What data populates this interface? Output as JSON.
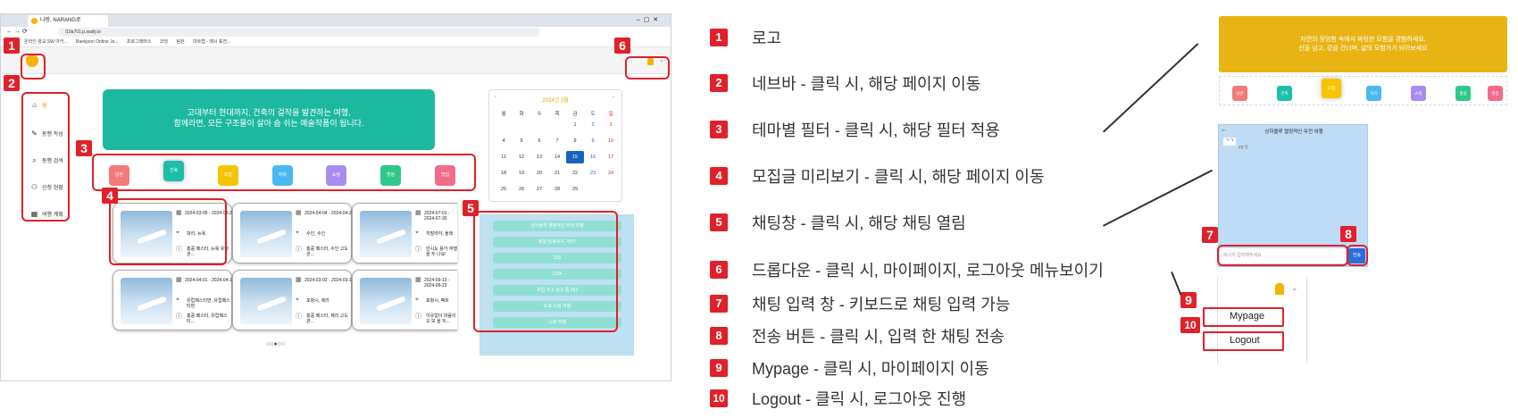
{
  "browser": {
    "tab_title": "나랑, NARANG로",
    "url": "i10a701.p.ssafy.io",
    "bookmarks": [
      "온라인 광교 SW 아카...",
      "Baekjoon Online Ju...",
      "프로그래머스",
      "코딩",
      "팀원",
      "마트랩 - 메시 표전..."
    ]
  },
  "sidebar": {
    "items": [
      {
        "icon": "home-icon",
        "label": "홈"
      },
      {
        "icon": "edit-icon",
        "label": "동행 작성"
      },
      {
        "icon": "search-icon",
        "label": "동행 검색"
      },
      {
        "icon": "user-add-icon",
        "label": "신청 현황"
      },
      {
        "icon": "calendar-icon",
        "label": "여행 계획"
      }
    ]
  },
  "hero": {
    "line1": "고대부터 현대까지, 건축의 걸작을 발견하는 여행,",
    "line2": "함께라면, 모든 구조물이 살아 숨 쉬는 예술작품이 됩니다."
  },
  "themes": [
    {
      "label": "낭만",
      "color": "#f27a7a"
    },
    {
      "label": "건축",
      "color": "#1dbfa8"
    },
    {
      "label": "모험",
      "color": "#f4c400"
    },
    {
      "label": "자유",
      "color": "#4ab8f0"
    },
    {
      "label": "쇼핑",
      "color": "#a88cf0"
    },
    {
      "label": "힐링",
      "color": "#2fc88a"
    },
    {
      "label": "맛집",
      "color": "#f26c8a"
    }
  ],
  "cards": [
    {
      "date": "2024-03-05 - 2024-03-22",
      "loc": "파리, 뉴욕",
      "desc": "홍콩 페스타, 뉴욕 유령 관..."
    },
    {
      "date": "2024-04-04 - 2024-04-20",
      "loc": "수인, 수인",
      "desc": "홍콩 페스타, 수인 고도 관..."
    },
    {
      "date": "2024-07-01 - 2024-07-30",
      "loc": "히말라야, 올레",
      "desc": "안시도 용가 여행을 두 나요!"
    },
    {
      "date": "2024-04-01 - 2024-04-10",
      "loc": "유럽페스티번, 유럽페스티번",
      "desc": "홍콩 페스타, 유럽페스티..."
    },
    {
      "date": "2024-03-02 - 2024-03-12",
      "loc": "포항시, 제리",
      "desc": "홍콩 페스타, 제리 고도 관..."
    },
    {
      "date": "2024-09-13 - 2024-09-23",
      "loc": "포항시, 팩트",
      "desc": "이유없이 마음이 오 보 을 뒤..."
    }
  ],
  "calendar": {
    "title": "2024년 2월",
    "weekdays": [
      "월",
      "화",
      "수",
      "목",
      "금",
      "토",
      "일"
    ],
    "rows": [
      [
        "",
        "",
        "",
        "",
        "1",
        "2",
        "3"
      ],
      [
        "4",
        "5",
        "6",
        "7",
        "8",
        "9",
        "10"
      ],
      [
        "11",
        "12",
        "13",
        "14",
        "15",
        "16",
        "17"
      ],
      [
        "18",
        "19",
        "20",
        "21",
        "22",
        "23",
        "24"
      ],
      [
        "25",
        "26",
        "27",
        "28",
        "29",
        "",
        ""
      ]
    ],
    "today": "15"
  },
  "chatlist": {
    "items": [
      "상하올루 열정적인 무전 여행",
      "제일 엄세워지 기타?",
      "123",
      "1234",
      "유럽 가고 싶고 좀 253",
      "도쿄 드림 여행",
      "니로 여행"
    ]
  },
  "legend": [
    {
      "num": "1",
      "text": "로고"
    },
    {
      "num": "2",
      "text": "네브바 - 클릭 시, 해당 페이지 이동"
    },
    {
      "num": "3",
      "text": "테마별 필터 - 클릭 시, 해당 필터 적용"
    },
    {
      "num": "4",
      "text": "모집글 미리보기 - 클릭 시, 해당 페이지 이동"
    },
    {
      "num": "5",
      "text": "채팅창 - 클릭 시, 해당 채팅 열림"
    },
    {
      "num": "6",
      "text": "드롭다운 - 클릭 시, 마이페이지, 로그아웃 메뉴보이기"
    },
    {
      "num": "7",
      "text": "채팅 입력 창 - 키보드로 채팅 입력 가능"
    },
    {
      "num": "8",
      "text": "전송 버튼 - 클릭 시, 입력 한 채팅 전송"
    },
    {
      "num": "9",
      "text": "Mypage - 클릭 시, 마이페이지 이동"
    },
    {
      "num": "10",
      "text": "Logout - 클릭 시, 로그아웃 진행"
    }
  ],
  "filter_preview": {
    "line1": "자연의 장엄함 속에서 짜릿한 모험을 경험하세요.",
    "line2": "산을 넘고, 강을 건너며, 삶의 모험가가 되어보세요"
  },
  "chat_preview": {
    "title": "상하올루 열정적인 무전 여행",
    "message": "ㄱㄱ",
    "time": "5분 전",
    "input_placeholder": "메시지 입력해주세요",
    "send_label": "전송"
  },
  "dropdown": {
    "mypage": "Mypage",
    "logout": "Logout"
  }
}
